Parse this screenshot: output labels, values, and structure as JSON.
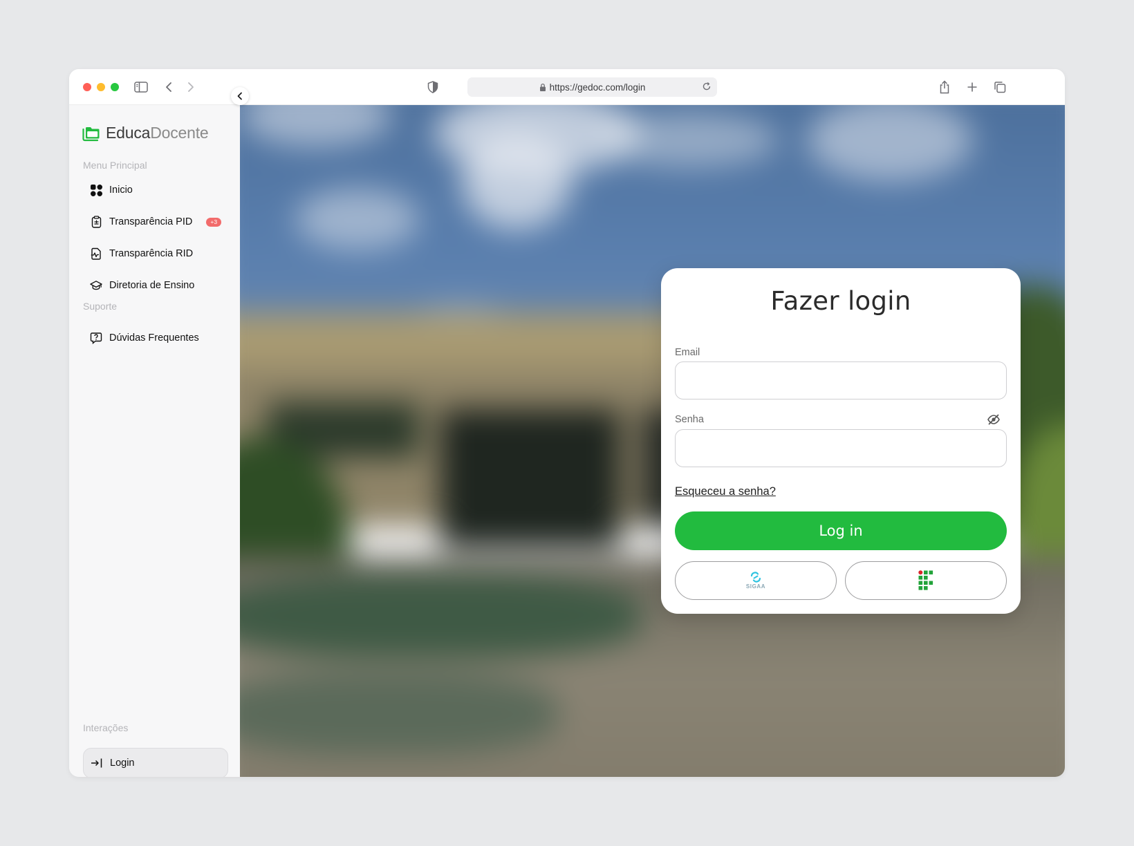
{
  "browser": {
    "url": "https://gedoc.com/login"
  },
  "sidebar": {
    "logo": {
      "part1": "Educa",
      "part2": "Docente"
    },
    "sections": {
      "main": "Menu Principal",
      "support": "Suporte",
      "interactions": "Interações"
    },
    "items": [
      {
        "label": "Inicio",
        "icon": "grid-icon"
      },
      {
        "label": "Transparência PID",
        "icon": "clipboard-icon",
        "badge": "+3"
      },
      {
        "label": "Transparência RID",
        "icon": "document-chart-icon"
      },
      {
        "label": "Diretoria de Ensino",
        "icon": "graduation-cap-icon"
      },
      {
        "label": "Dúvidas Frequentes",
        "icon": "question-chat-icon"
      }
    ],
    "login": {
      "label": "Login",
      "icon": "login-arrow-icon"
    }
  },
  "login_card": {
    "title": "Fazer login",
    "email_label": "Email",
    "email_value": "",
    "password_label": "Senha",
    "password_value": "",
    "forgot": "Esqueceu a senha?",
    "submit": "Log in",
    "sigaa_text": "SIGAA"
  },
  "colors": {
    "accent_green": "#22bb3f",
    "badge_red": "#f26b6b"
  }
}
